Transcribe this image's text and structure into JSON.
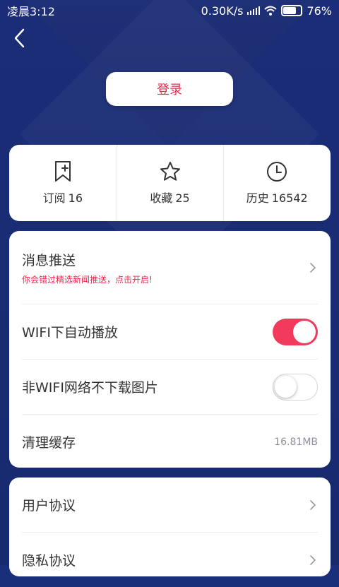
{
  "status_bar": {
    "time": "凌晨3:12",
    "speed": "0.30K/s",
    "battery": "76%",
    "battery_level": 0.76
  },
  "header": {
    "login_label": "登录"
  },
  "stats": [
    {
      "label": "订阅",
      "count": "16",
      "icon": "bookmark-add-icon"
    },
    {
      "label": "收藏",
      "count": "25",
      "icon": "star-icon"
    },
    {
      "label": "历史",
      "count": "16542",
      "icon": "clock-icon"
    }
  ],
  "settings": {
    "push": {
      "label": "消息推送",
      "sub": "你会错过精选新闻推送，点击开启!"
    },
    "wifi_autoplay": {
      "label": "WIFI下自动播放",
      "enabled": true
    },
    "no_wifi_images": {
      "label": "非WIFI网络不下载图片",
      "enabled": false
    },
    "clear_cache": {
      "label": "清理缓存",
      "value": "16.81MB"
    }
  },
  "legal": {
    "user_agreement": "用户协议",
    "privacy_agreement": "隐私协议"
  },
  "colors": {
    "background": "#1b2d78",
    "accent": "#f0294e",
    "toggle_on": "#f23a5c"
  }
}
